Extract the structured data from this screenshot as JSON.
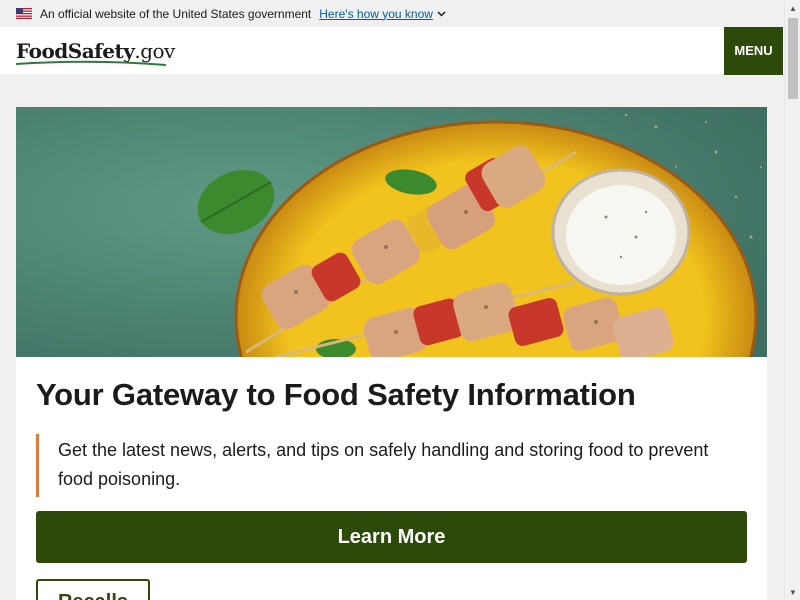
{
  "gov_banner": {
    "text": "An official website of the United States government",
    "link_text": "Here's how you know",
    "chevron_icon": "chevron-down-icon"
  },
  "header": {
    "logo_main": "FoodSafety",
    "logo_tld": ".gov",
    "menu_label": "MENU"
  },
  "hero": {
    "image": "grilled-chicken-skewers-with-dip-photo",
    "title": "Your Gateway to Food Safety Information",
    "description": "Get the latest news, alerts, and tips on safely handling and storing food to prevent food poisoning.",
    "primary_button": "Learn More",
    "secondary_button": "Recalls"
  },
  "colors": {
    "brand_green": "#2d4a0b",
    "accent_orange": "#e07b39",
    "link_blue": "#005ea2",
    "banner_bg": "#f0f0f0"
  }
}
